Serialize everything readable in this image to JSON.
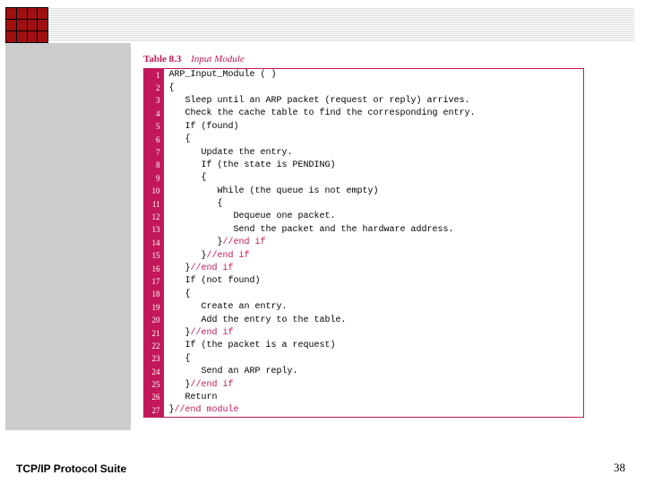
{
  "header": {
    "table_label": "Table 8.3",
    "table_caption": "Input Module"
  },
  "code": {
    "lines": [
      {
        "n": 1,
        "text": "ARP_Input_Module ( )",
        "comment": ""
      },
      {
        "n": 2,
        "text": "{",
        "comment": ""
      },
      {
        "n": 3,
        "text": "   Sleep until an ARP packet (request or reply) arrives.",
        "comment": ""
      },
      {
        "n": 4,
        "text": "   Check the cache table to find the corresponding entry.",
        "comment": ""
      },
      {
        "n": 5,
        "text": "   If (found)",
        "comment": ""
      },
      {
        "n": 6,
        "text": "   {",
        "comment": ""
      },
      {
        "n": 7,
        "text": "      Update the entry.",
        "comment": ""
      },
      {
        "n": 8,
        "text": "      If (the state is PENDING)",
        "comment": ""
      },
      {
        "n": 9,
        "text": "      {",
        "comment": ""
      },
      {
        "n": 10,
        "text": "         While (the queue is not empty)",
        "comment": ""
      },
      {
        "n": 11,
        "text": "         {",
        "comment": ""
      },
      {
        "n": 12,
        "text": "            Dequeue one packet.",
        "comment": ""
      },
      {
        "n": 13,
        "text": "            Send the packet and the hardware address.",
        "comment": ""
      },
      {
        "n": 14,
        "text": "         }",
        "comment": "//end if"
      },
      {
        "n": 15,
        "text": "      }",
        "comment": "//end if"
      },
      {
        "n": 16,
        "text": "   }",
        "comment": "//end if"
      },
      {
        "n": 17,
        "text": "   If (not found)",
        "comment": ""
      },
      {
        "n": 18,
        "text": "   {",
        "comment": ""
      },
      {
        "n": 19,
        "text": "      Create an entry.",
        "comment": ""
      },
      {
        "n": 20,
        "text": "      Add the entry to the table.",
        "comment": ""
      },
      {
        "n": 21,
        "text": "   }",
        "comment": "//end if"
      },
      {
        "n": 22,
        "text": "   If (the packet is a request)",
        "comment": ""
      },
      {
        "n": 23,
        "text": "   {",
        "comment": ""
      },
      {
        "n": 24,
        "text": "      Send an ARP reply.",
        "comment": ""
      },
      {
        "n": 25,
        "text": "   }",
        "comment": "//end if"
      },
      {
        "n": 26,
        "text": "   Return",
        "comment": ""
      },
      {
        "n": 27,
        "text": "}",
        "comment": "//end module"
      }
    ]
  },
  "footer": {
    "left": "TCP/IP Protocol Suite",
    "page": "38"
  }
}
